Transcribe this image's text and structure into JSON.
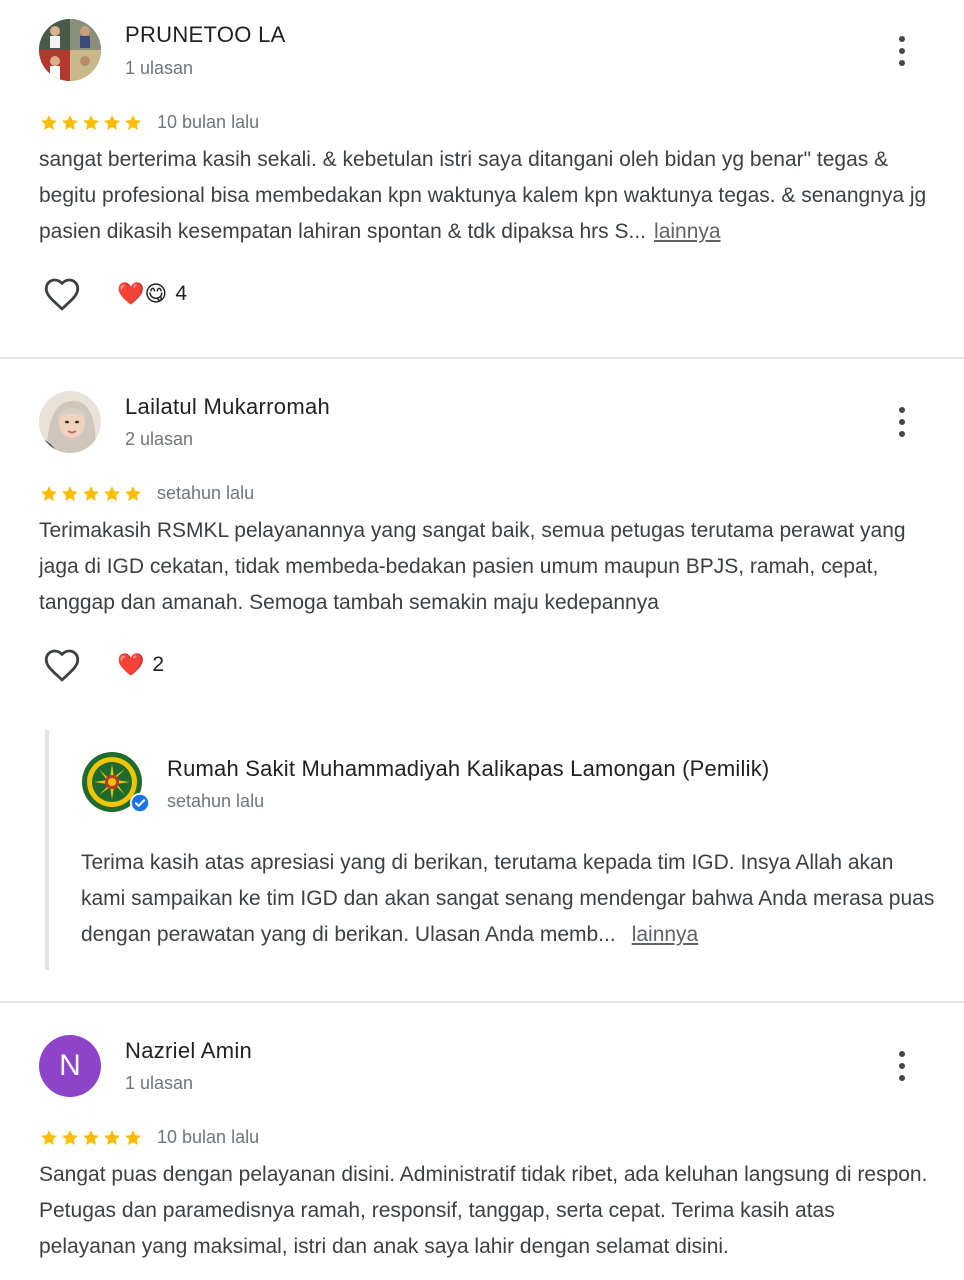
{
  "reviews": [
    {
      "name": "PRUNETOO LA",
      "count": "1 ulasan",
      "rating": 5,
      "time": "10 bulan lalu",
      "text": "sangat berterima kasih sekali. & kebetulan istri saya ditangani oleh bidan yg benar\" tegas & begitu profesional bisa membedakan kpn waktunya kalem kpn waktunya tegas. & senangnya jg pasien dikasih kesempatan lahiran spontan & tdk dipaksa hrs S...",
      "more": "lainnya",
      "reactions": "❤️😋",
      "reaction_count": "4"
    },
    {
      "name": "Lailatul Mukarromah",
      "count": "2 ulasan",
      "rating": 5,
      "time": "setahun lalu",
      "text": "Terimakasih RSMKL pelayanannya yang sangat baik, semua petugas terutama perawat yang jaga di IGD cekatan, tidak membeda-bedakan pasien umum maupun BPJS, ramah, cepat, tanggap dan amanah. Semoga tambah semakin maju kedepannya",
      "reactions": "❤️",
      "reaction_count": "2",
      "owner_reply": {
        "name": "Rumah Sakit Muhammadiyah Kalikapas Lamongan (Pemilik)",
        "time": "setahun lalu",
        "text": "Terima kasih atas apresiasi yang di berikan, terutama kepada tim IGD. Insya Allah akan kami sampaikan ke tim IGD dan akan sangat senang mendengar bahwa Anda merasa puas dengan perawatan yang di berikan. Ulasan Anda memb...",
        "more": "lainnya"
      }
    },
    {
      "name": "Nazriel Amin",
      "initial": "N",
      "count": "1 ulasan",
      "rating": 5,
      "time": "10 bulan lalu",
      "text": "Sangat puas dengan pelayanan disini. Administratif tidak ribet, ada keluhan langsung di respon. Petugas dan paramedisnya ramah, responsif, tanggap, serta cepat. Terima kasih atas pelayanan yang maksimal, istri dan anak saya lahir dengan selamat disini."
    }
  ],
  "colors": {
    "star": "#fbbc04",
    "muted": "#70757a",
    "avatar_n": "#8e44c9",
    "verified": "#1a73e8"
  }
}
